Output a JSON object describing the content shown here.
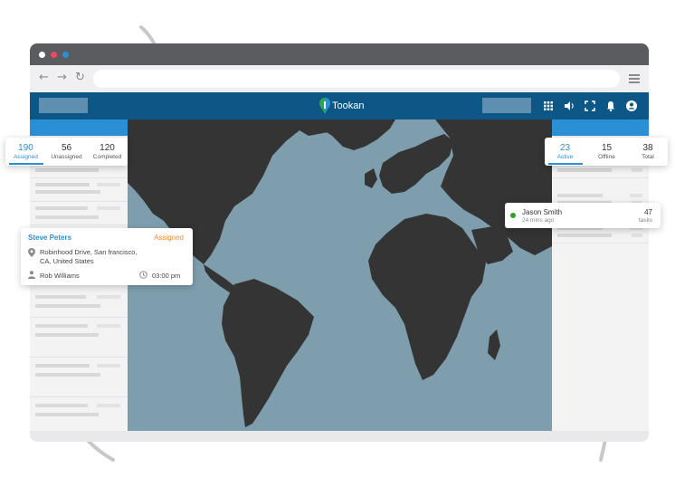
{
  "header": {
    "brand": "Tookan"
  },
  "left_tabs": [
    {
      "count": "190",
      "label": "Assigned",
      "active": true
    },
    {
      "count": "56",
      "label": "Unassigned",
      "active": false
    },
    {
      "count": "120",
      "label": "Completed",
      "active": false
    }
  ],
  "right_tabs": [
    {
      "count": "23",
      "label": "Active",
      "active": true
    },
    {
      "count": "15",
      "label": "Offline",
      "active": false
    },
    {
      "count": "38",
      "label": "Total",
      "active": false
    }
  ],
  "task_card": {
    "name": "Steve Peters",
    "status": "Assigned",
    "address_line1": "Robinhood Drive, San francisco,",
    "address_line2": "CA, United States",
    "agent": "Rob Williams",
    "time": "03:00 pm",
    "icons": [
      "location-pin-icon",
      "person-icon",
      "clock-icon"
    ]
  },
  "agent_card": {
    "name": "Jason Smith",
    "last_seen": "24 mins ago",
    "tasks_count": "47",
    "tasks_label": "tasks",
    "status_color": "#2ca02c"
  },
  "colors": {
    "header": "#0d5787",
    "accent": "#2b8fd6",
    "status_orange": "#f28b30",
    "map_water": "#7e9eae",
    "map_land": "#343434"
  }
}
